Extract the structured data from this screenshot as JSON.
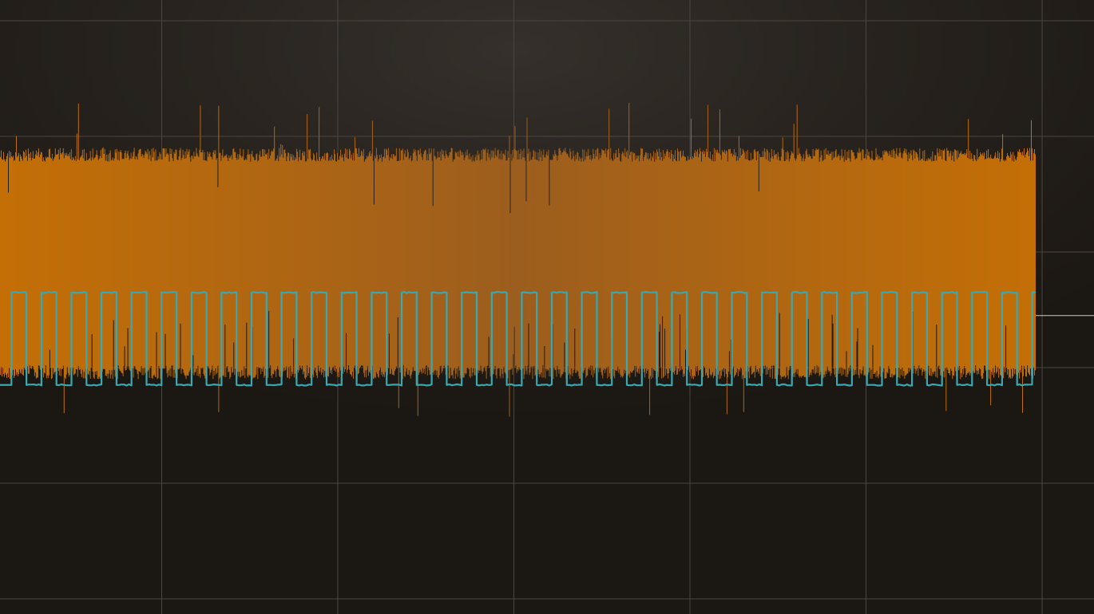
{
  "chart_data": {
    "type": "line",
    "title": "",
    "xlabel": "",
    "ylabel": "",
    "grid": true,
    "legend": "none",
    "x_divisions": 6,
    "y_divisions": 5,
    "series": [
      {
        "kind": "noise-band",
        "color": "#c46f06",
        "color_mid": "#9c5e1e",
        "samples": 1300,
        "band_top": 3.9,
        "band_bottom": 1.9,
        "spike_max": 4.3,
        "spike_min": 1.55
      },
      {
        "kind": "square-wave",
        "color": "#3aa8b2",
        "cycles": 34.5,
        "high": 2.65,
        "low": 1.85,
        "duty": 0.5
      }
    ],
    "trigger_level": 2.45,
    "ylim": [
      0,
      5
    ],
    "xlim": [
      0,
      1
    ]
  }
}
